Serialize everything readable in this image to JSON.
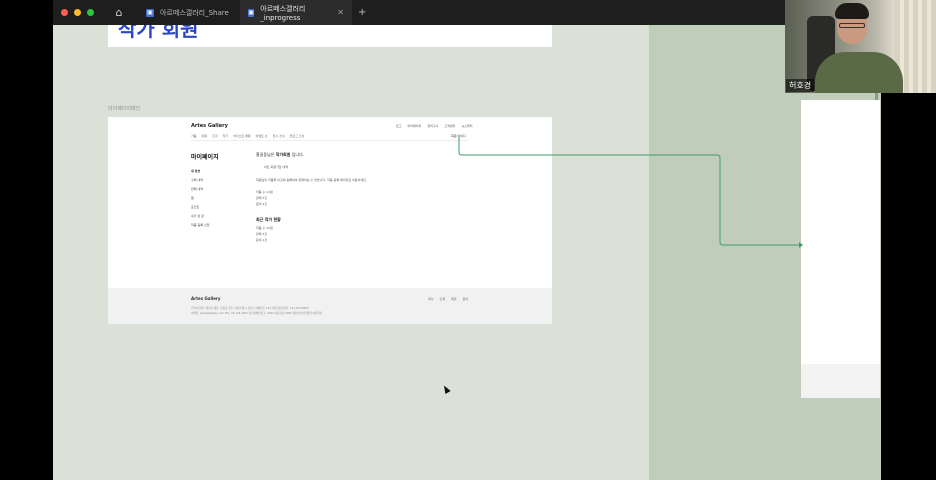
{
  "window": {
    "traffic_colors": [
      "#ff5f57",
      "#febc2e",
      "#28c840"
    ],
    "home_icon": "home-icon",
    "tabs": [
      {
        "label": "아르떼스갤러리_Share",
        "favicon": "figma-icon",
        "active": false
      },
      {
        "label": "아르떼스갤러리_inprogress",
        "favicon": "figma-icon",
        "active": true
      }
    ],
    "new_tab_icon": "plus-icon",
    "close_icon": "close-icon"
  },
  "canvas": {
    "top_frame_heading": "작가 회원",
    "frame_label": "마이페이지메인",
    "connector_color": "#3f9a6b"
  },
  "mockup": {
    "brand": "Artes Gallery",
    "topnav": [
      "로그",
      "마이페이지",
      "장바구니",
      "고객센터",
      "뉴스레터"
    ],
    "subnav": [
      "가품",
      "판화",
      "조각",
      "작가",
      "아티스트 배틀",
      "이벤트 쇼",
      "전시 소식",
      "블로그 소식"
    ],
    "user_item": "회원 아이디",
    "page_title": "마이페이지",
    "side_menu": [
      "내 정보",
      "구매 내역",
      "판매 내역",
      "찜",
      "포인트",
      "내가 쓴 글",
      "작품 등록 신청"
    ],
    "welcome_prefix": "홍길동님은",
    "welcome_bold": "작가회원",
    "welcome_suffix": "입니다.",
    "tag": "아트 회원가입 내역",
    "desc": "회원님의 작품을 이곳에 등록하여 판매하실 수 있습니다. 작품 등록 페이지로 이동하세요.",
    "info_rows": [
      "작품 수   12점",
      "판매   3건",
      "문의   2건"
    ],
    "section_title": "최근 작가 현황",
    "section_rows": [
      "작품 수   12점",
      "판매   3건",
      "문의   2건"
    ],
    "footer": {
      "brand": "Artes Gallery",
      "line1": "(주)아르떼스 갤러리   대표: 홍길동   주소: 서울특별시 강남구 테헤란로 123   사업자등록번호: 123-45-67890",
      "line2": "이메일: artes@gallery.com   TEL: 02-123-4567   통신판매업신고: 2023-서울강남-0000   개인정보처리방침   이용약관",
      "links": [
        "회사",
        "인재",
        "제휴",
        "문의"
      ]
    }
  },
  "video": {
    "participant_name": "허호경"
  }
}
